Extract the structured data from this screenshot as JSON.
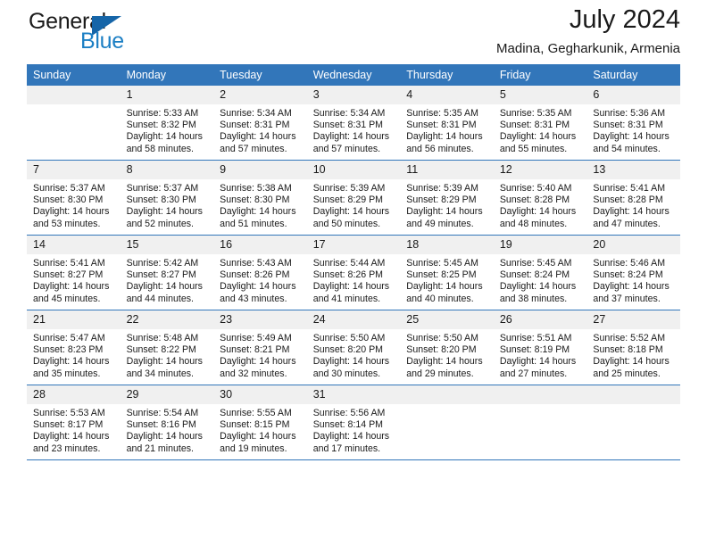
{
  "logo": {
    "word_one": "General",
    "word_two": "Blue",
    "triangle_icon": "triangle-icon"
  },
  "header": {
    "title": "July 2024",
    "subtitle": "Madina, Gegharkunik, Armenia"
  },
  "calendar": {
    "weekday_headers": [
      "Sunday",
      "Monday",
      "Tuesday",
      "Wednesday",
      "Thursday",
      "Friday",
      "Saturday"
    ],
    "accent_color": "#3276ba",
    "daynum_bg": "#f0f0f0",
    "weeks": [
      [
        {
          "day": "",
          "lines": []
        },
        {
          "day": "1",
          "lines": [
            "Sunrise: 5:33 AM",
            "Sunset: 8:32 PM",
            "Daylight: 14 hours",
            "and 58 minutes."
          ]
        },
        {
          "day": "2",
          "lines": [
            "Sunrise: 5:34 AM",
            "Sunset: 8:31 PM",
            "Daylight: 14 hours",
            "and 57 minutes."
          ]
        },
        {
          "day": "3",
          "lines": [
            "Sunrise: 5:34 AM",
            "Sunset: 8:31 PM",
            "Daylight: 14 hours",
            "and 57 minutes."
          ]
        },
        {
          "day": "4",
          "lines": [
            "Sunrise: 5:35 AM",
            "Sunset: 8:31 PM",
            "Daylight: 14 hours",
            "and 56 minutes."
          ]
        },
        {
          "day": "5",
          "lines": [
            "Sunrise: 5:35 AM",
            "Sunset: 8:31 PM",
            "Daylight: 14 hours",
            "and 55 minutes."
          ]
        },
        {
          "day": "6",
          "lines": [
            "Sunrise: 5:36 AM",
            "Sunset: 8:31 PM",
            "Daylight: 14 hours",
            "and 54 minutes."
          ]
        }
      ],
      [
        {
          "day": "7",
          "lines": [
            "Sunrise: 5:37 AM",
            "Sunset: 8:30 PM",
            "Daylight: 14 hours",
            "and 53 minutes."
          ]
        },
        {
          "day": "8",
          "lines": [
            "Sunrise: 5:37 AM",
            "Sunset: 8:30 PM",
            "Daylight: 14 hours",
            "and 52 minutes."
          ]
        },
        {
          "day": "9",
          "lines": [
            "Sunrise: 5:38 AM",
            "Sunset: 8:30 PM",
            "Daylight: 14 hours",
            "and 51 minutes."
          ]
        },
        {
          "day": "10",
          "lines": [
            "Sunrise: 5:39 AM",
            "Sunset: 8:29 PM",
            "Daylight: 14 hours",
            "and 50 minutes."
          ]
        },
        {
          "day": "11",
          "lines": [
            "Sunrise: 5:39 AM",
            "Sunset: 8:29 PM",
            "Daylight: 14 hours",
            "and 49 minutes."
          ]
        },
        {
          "day": "12",
          "lines": [
            "Sunrise: 5:40 AM",
            "Sunset: 8:28 PM",
            "Daylight: 14 hours",
            "and 48 minutes."
          ]
        },
        {
          "day": "13",
          "lines": [
            "Sunrise: 5:41 AM",
            "Sunset: 8:28 PM",
            "Daylight: 14 hours",
            "and 47 minutes."
          ]
        }
      ],
      [
        {
          "day": "14",
          "lines": [
            "Sunrise: 5:41 AM",
            "Sunset: 8:27 PM",
            "Daylight: 14 hours",
            "and 45 minutes."
          ]
        },
        {
          "day": "15",
          "lines": [
            "Sunrise: 5:42 AM",
            "Sunset: 8:27 PM",
            "Daylight: 14 hours",
            "and 44 minutes."
          ]
        },
        {
          "day": "16",
          "lines": [
            "Sunrise: 5:43 AM",
            "Sunset: 8:26 PM",
            "Daylight: 14 hours",
            "and 43 minutes."
          ]
        },
        {
          "day": "17",
          "lines": [
            "Sunrise: 5:44 AM",
            "Sunset: 8:26 PM",
            "Daylight: 14 hours",
            "and 41 minutes."
          ]
        },
        {
          "day": "18",
          "lines": [
            "Sunrise: 5:45 AM",
            "Sunset: 8:25 PM",
            "Daylight: 14 hours",
            "and 40 minutes."
          ]
        },
        {
          "day": "19",
          "lines": [
            "Sunrise: 5:45 AM",
            "Sunset: 8:24 PM",
            "Daylight: 14 hours",
            "and 38 minutes."
          ]
        },
        {
          "day": "20",
          "lines": [
            "Sunrise: 5:46 AM",
            "Sunset: 8:24 PM",
            "Daylight: 14 hours",
            "and 37 minutes."
          ]
        }
      ],
      [
        {
          "day": "21",
          "lines": [
            "Sunrise: 5:47 AM",
            "Sunset: 8:23 PM",
            "Daylight: 14 hours",
            "and 35 minutes."
          ]
        },
        {
          "day": "22",
          "lines": [
            "Sunrise: 5:48 AM",
            "Sunset: 8:22 PM",
            "Daylight: 14 hours",
            "and 34 minutes."
          ]
        },
        {
          "day": "23",
          "lines": [
            "Sunrise: 5:49 AM",
            "Sunset: 8:21 PM",
            "Daylight: 14 hours",
            "and 32 minutes."
          ]
        },
        {
          "day": "24",
          "lines": [
            "Sunrise: 5:50 AM",
            "Sunset: 8:20 PM",
            "Daylight: 14 hours",
            "and 30 minutes."
          ]
        },
        {
          "day": "25",
          "lines": [
            "Sunrise: 5:50 AM",
            "Sunset: 8:20 PM",
            "Daylight: 14 hours",
            "and 29 minutes."
          ]
        },
        {
          "day": "26",
          "lines": [
            "Sunrise: 5:51 AM",
            "Sunset: 8:19 PM",
            "Daylight: 14 hours",
            "and 27 minutes."
          ]
        },
        {
          "day": "27",
          "lines": [
            "Sunrise: 5:52 AM",
            "Sunset: 8:18 PM",
            "Daylight: 14 hours",
            "and 25 minutes."
          ]
        }
      ],
      [
        {
          "day": "28",
          "lines": [
            "Sunrise: 5:53 AM",
            "Sunset: 8:17 PM",
            "Daylight: 14 hours",
            "and 23 minutes."
          ]
        },
        {
          "day": "29",
          "lines": [
            "Sunrise: 5:54 AM",
            "Sunset: 8:16 PM",
            "Daylight: 14 hours",
            "and 21 minutes."
          ]
        },
        {
          "day": "30",
          "lines": [
            "Sunrise: 5:55 AM",
            "Sunset: 8:15 PM",
            "Daylight: 14 hours",
            "and 19 minutes."
          ]
        },
        {
          "day": "31",
          "lines": [
            "Sunrise: 5:56 AM",
            "Sunset: 8:14 PM",
            "Daylight: 14 hours",
            "and 17 minutes."
          ]
        },
        {
          "day": "",
          "lines": []
        },
        {
          "day": "",
          "lines": []
        },
        {
          "day": "",
          "lines": []
        }
      ]
    ]
  }
}
